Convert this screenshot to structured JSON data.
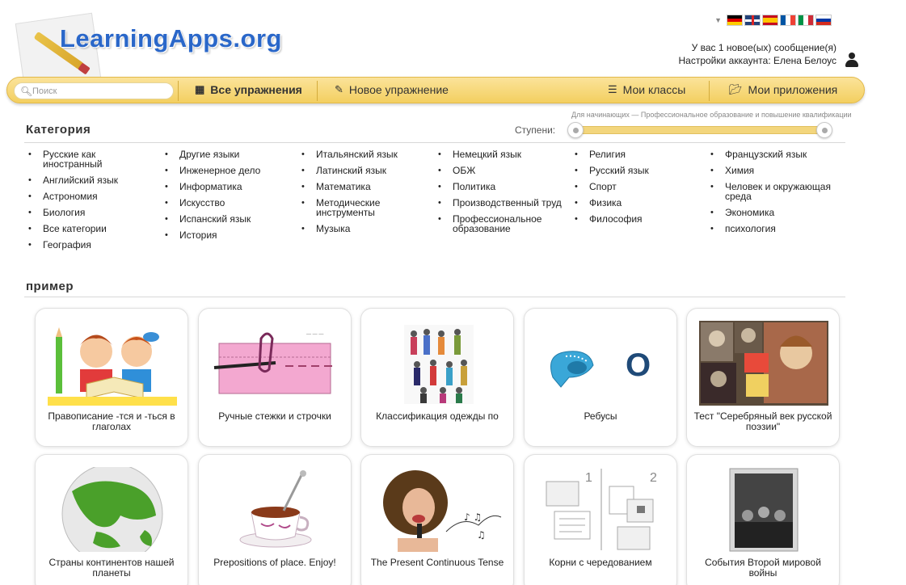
{
  "header": {
    "logo_text": "LearningApps.org",
    "messages_text": "У вас 1 новое(ых) сообщение(я)",
    "account_text": "Настройки аккаунта: Елена Белоус"
  },
  "languages": [
    "de",
    "gb",
    "es",
    "fr",
    "it",
    "ru"
  ],
  "nav": {
    "search_placeholder": "Поиск",
    "all_exercises": "Все упражнения",
    "new_exercise": "Новое упражнение",
    "my_classes": "Мои классы",
    "my_apps": "Мои приложения"
  },
  "category": {
    "title": "Категория",
    "level_note": "Для начинающих — Профессиональное образование и повышение квалификации",
    "level_label": "Ступени:",
    "columns": [
      [
        "Русские как иностранный",
        "Английский язык",
        "Астрономия",
        "Биология",
        "Все категории",
        "География"
      ],
      [
        "Другие языки",
        "Инженерное дело",
        "Информатика",
        "Искусство",
        "Испанский язык",
        "История"
      ],
      [
        "Итальянский язык",
        "Латинский язык",
        "Математика",
        "Методические инструменты",
        "Музыка"
      ],
      [
        "Немецкий язык",
        "ОБЖ",
        "Политика",
        "Производственный труд",
        "Профессиональное образование"
      ],
      [
        "Религия",
        "Русский язык",
        "Спорт",
        "Физика",
        "Философия"
      ],
      [
        "Французский язык",
        "Химия",
        "Человек и окружающая среда",
        "Экономика",
        "психология"
      ]
    ]
  },
  "examples": {
    "title": "пример",
    "cards": [
      "Правописание -тся и -ться в глаголах",
      "Ручные стежки и строчки",
      "Классификация одежды по",
      "Ребусы",
      "Тест \"Серебряный век русской поэзии\"",
      "Страны континентов нашей планеты",
      "Prepositions of place. Enjoy!",
      "The Present Continuous Tense",
      "Корни с чередованием",
      "События Второй мировой войны"
    ],
    "thumb_texts": {
      "rebus_letter": "О",
      "roots_num1": "1",
      "roots_num2": "2"
    }
  }
}
